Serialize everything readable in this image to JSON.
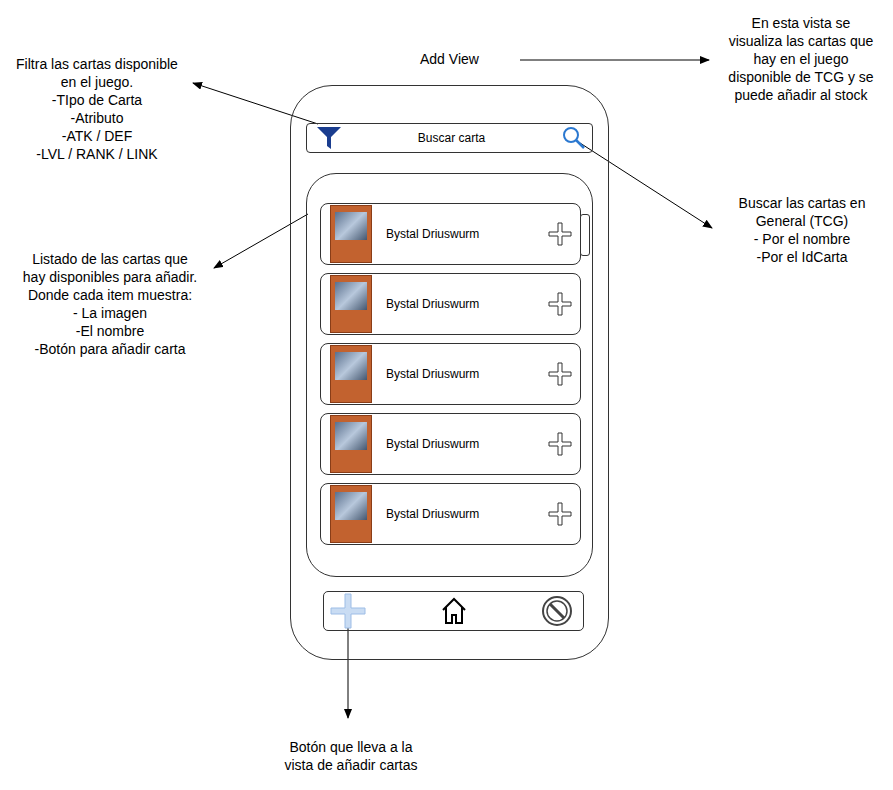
{
  "title": "Add View",
  "annotations": {
    "filter": [
      "Filtra las cartas disponible",
      "en el juego.",
      "-TIpo de Carta",
      "-Atributo",
      "-ATK / DEF",
      "-LVL / RANK / LINK"
    ],
    "view": [
      "En esta vista se",
      "visualiza las cartas que",
      "hay en el juego",
      "disponible de TCG y se",
      "puede añadir al stock"
    ],
    "search": [
      "Buscar las cartas en",
      "General (TCG)",
      "- Por el nombre",
      "-Por el IdCarta"
    ],
    "list": [
      "Listado de las cartas que",
      "hay disponibles para añadir.",
      "Donde cada item muestra:",
      "- La imagen",
      "-El nombre",
      "-Botón para añadir carta"
    ],
    "nav": [
      "Botón que lleva a la",
      "vista de añadir cartas"
    ]
  },
  "search": {
    "placeholder": "Buscar carta"
  },
  "cards": [
    {
      "name": "Bystal Driuswurm"
    },
    {
      "name": "Bystal Driuswurm"
    },
    {
      "name": "Bystal Driuswurm"
    },
    {
      "name": "Bystal Driuswurm"
    },
    {
      "name": "Bystal Driuswurm"
    }
  ],
  "nav": [
    {
      "kind": "add",
      "selected": true
    },
    {
      "kind": "home",
      "selected": false
    },
    {
      "kind": "ban",
      "selected": false
    }
  ]
}
